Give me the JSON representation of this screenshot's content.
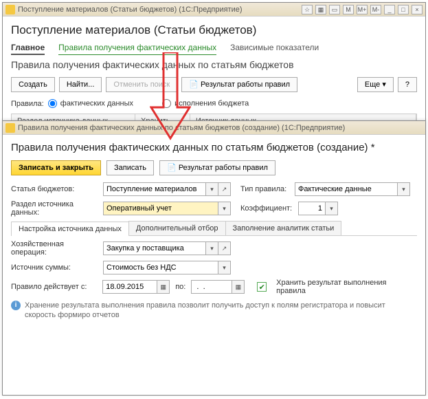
{
  "win1": {
    "title": "Поступление материалов (Статьи бюджетов)   (1С:Предприятие)",
    "page_title": "Поступление материалов (Статьи бюджетов)",
    "top_tabs": {
      "main": "Главное",
      "rules": "Правила получения фактических данных",
      "dep": "Зависимые показатели"
    },
    "subtitle": "Правила получения фактических данных по статьям бюджетов",
    "toolbar": {
      "create": "Создать",
      "find": "Найти...",
      "cancel_search": "Отменить поиск",
      "results": "Результат работы правил",
      "more": "Еще",
      "help": "?"
    },
    "rules_label": "Правила:",
    "radio1": "фактических данных",
    "radio2": "исполнения бюджета",
    "cols": {
      "c1": "Раздел источника данных",
      "c2": "Хранить",
      "c3": "Источник данных"
    }
  },
  "win2": {
    "title": "Правила получения фактических данных по статьям бюджетов (создание)   (1С:Предприятие)",
    "form_title": "Правила получения фактических данных по статьям бюджетов (создание) *",
    "toolbar": {
      "save_close": "Записать и закрыть",
      "save": "Записать",
      "results": "Результат работы правил"
    },
    "labels": {
      "article": "Статья бюджетов:",
      "rule_type": "Тип правила:",
      "section": "Раздел источника данных:",
      "coef": "Коэффициент:",
      "op": "Хозяйственная операция:",
      "sum_src": "Источник суммы:",
      "valid_from": "Правило действует с:",
      "to": "по:",
      "store": "Хранить результат выполнения правила"
    },
    "values": {
      "article": "Поступление материалов",
      "rule_type": "Фактические данные",
      "section": "Оперативный учет",
      "coef": "1",
      "op": "Закупка у поставщика",
      "sum_src": "Стоимость без НДС",
      "date_from": "18.09.2015",
      "date_to": " .  ."
    },
    "tabs": {
      "t1": "Настройка источника данных",
      "t2": "Дополнительный отбор",
      "t3": "Заполнение аналитик статьи"
    },
    "info": "Хранение результата выполнения правила позволит получить доступ к полям регистратора и повысит скорость формиро отчетов"
  }
}
